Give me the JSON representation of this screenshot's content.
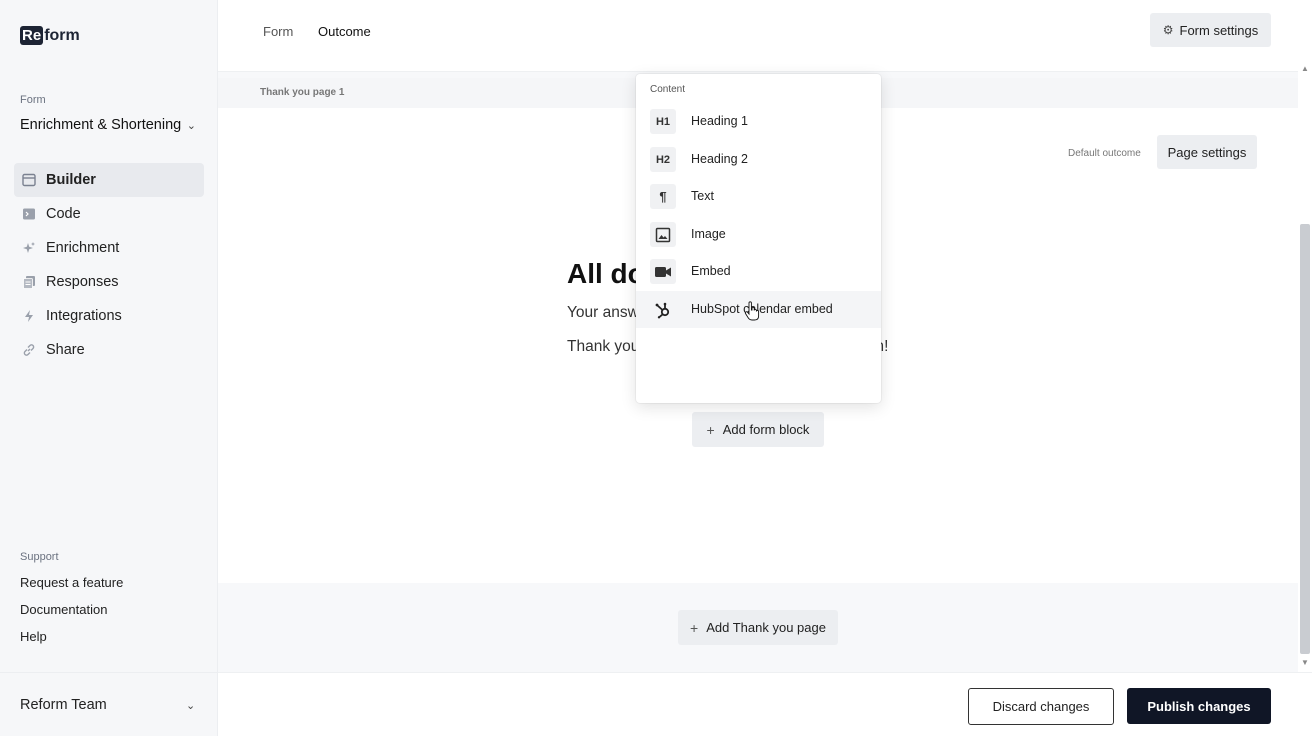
{
  "sidebar": {
    "logo_mark": "Re",
    "logo_rest": "form",
    "form_label": "Form",
    "form_name": "Enrichment & Shortening",
    "nav": [
      {
        "label": "Builder",
        "icon": "window-icon",
        "active": true
      },
      {
        "label": "Code",
        "icon": "terminal-icon",
        "active": false
      },
      {
        "label": "Enrichment",
        "icon": "sparkles-icon",
        "active": false
      },
      {
        "label": "Responses",
        "icon": "documents-icon",
        "active": false
      },
      {
        "label": "Integrations",
        "icon": "bolt-icon",
        "active": false
      },
      {
        "label": "Share",
        "icon": "link-icon",
        "active": false
      }
    ],
    "support_label": "Support",
    "support_links": [
      "Request a feature",
      "Documentation",
      "Help"
    ],
    "team_name": "Reform Team"
  },
  "header": {
    "tabs": [
      {
        "label": "Form",
        "active": false
      },
      {
        "label": "Outcome",
        "active": true
      }
    ],
    "form_settings_label": "Form settings"
  },
  "canvas": {
    "page_label": "Thank you page 1",
    "default_outcome": "Default outcome",
    "page_settings_label": "Page settings",
    "heading_visible": "All do",
    "para1_visible": "Your answ",
    "para2_visible": "Thank you",
    "para2_tail": "rm!",
    "add_block_label": "Add form block",
    "add_page_label": "Add Thank you page"
  },
  "dropdown": {
    "section": "Content",
    "items": [
      {
        "badge": "H1",
        "label": "Heading 1",
        "icon": "heading-1-icon"
      },
      {
        "badge": "H2",
        "label": "Heading 2",
        "icon": "heading-2-icon"
      },
      {
        "badge": "¶",
        "label": "Text",
        "icon": "paragraph-icon"
      },
      {
        "badge": "",
        "label": "Image",
        "icon": "image-icon"
      },
      {
        "badge": "",
        "label": "Embed",
        "icon": "video-icon"
      },
      {
        "badge": "",
        "label": "HubSpot calendar embed",
        "icon": "hubspot-icon",
        "hover": true
      }
    ]
  },
  "footer": {
    "discard_label": "Discard changes",
    "publish_label": "Publish changes"
  },
  "colors": {
    "primary_dark": "#101626",
    "sidebar_bg": "#f6f7f9",
    "button_bg": "#eceef1"
  }
}
